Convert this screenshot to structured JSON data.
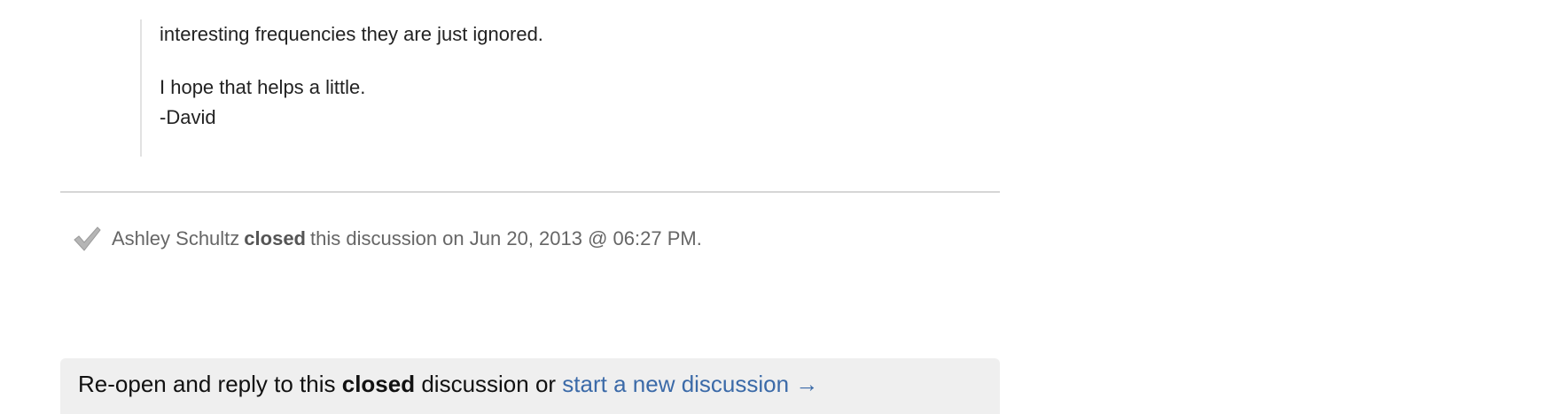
{
  "message": {
    "line_1": "interesting frequencies they are just ignored.",
    "line_2": "I hope that helps a little.",
    "line_3": "-David"
  },
  "closed_event": {
    "icon": "check-icon",
    "actor": "Ashley Schultz",
    "action": "closed",
    "rest": "this discussion on Jun 20, 2013 @ 06:27 PM."
  },
  "reply_bar": {
    "text_before": "Re-open and reply to this ",
    "bold_word": "closed",
    "text_middle": " discussion or ",
    "link_label": "start a new discussion →"
  },
  "colors": {
    "link": "#3b6aa8",
    "reply_bar_background": "#efefef",
    "divider": "#d6d6d6"
  }
}
